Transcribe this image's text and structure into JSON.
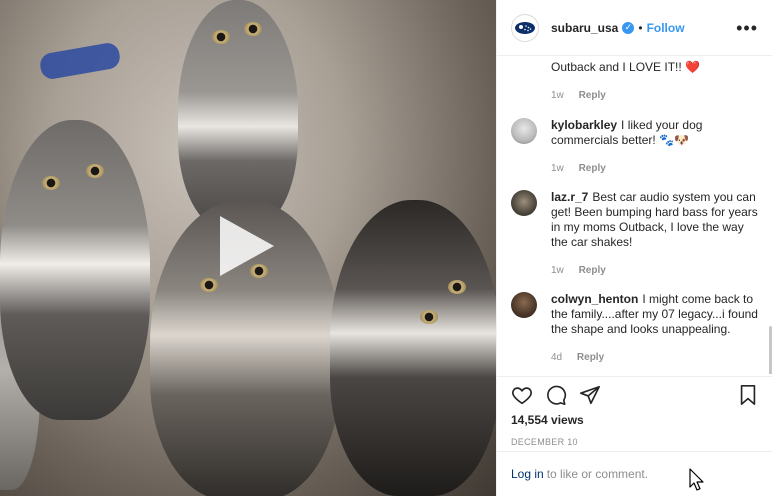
{
  "post": {
    "username": "subaru_usa",
    "follow_label": "Follow",
    "separator": "•",
    "more_label": "•••"
  },
  "comments": [
    {
      "user": "",
      "text": "Outback and I LOVE IT!!",
      "emoji": "❤️",
      "time": "1w",
      "reply": "Reply"
    },
    {
      "user": "kylobarkley",
      "text": "I liked your dog commercials better!",
      "emoji": "🐾🐶",
      "time": "1w",
      "reply": "Reply"
    },
    {
      "user": "laz.r_7",
      "text": "Best car audio system you can get! Been bumping hard bass for years in my moms Outback, I love the way the car shakes!",
      "emoji": "",
      "time": "1w",
      "reply": "Reply"
    },
    {
      "user": "colwyn_henton",
      "text": "I might come back to the family....after my 07 legacy...i found the shape and looks unappealing.",
      "emoji": "",
      "time": "4d",
      "reply": "Reply"
    }
  ],
  "stats": {
    "views": "14,554 views",
    "date": "DECEMBER 10"
  },
  "login": {
    "link": "Log in",
    "text": "to like or comment."
  },
  "icons": {
    "like": "heart-icon",
    "comment": "comment-icon",
    "share": "share-icon",
    "save": "bookmark-icon",
    "play": "play-icon",
    "verified": "verified-badge-icon"
  },
  "colors": {
    "accent": "#3897f0",
    "heart": "#ed4956",
    "muted": "#8e8e8e"
  }
}
